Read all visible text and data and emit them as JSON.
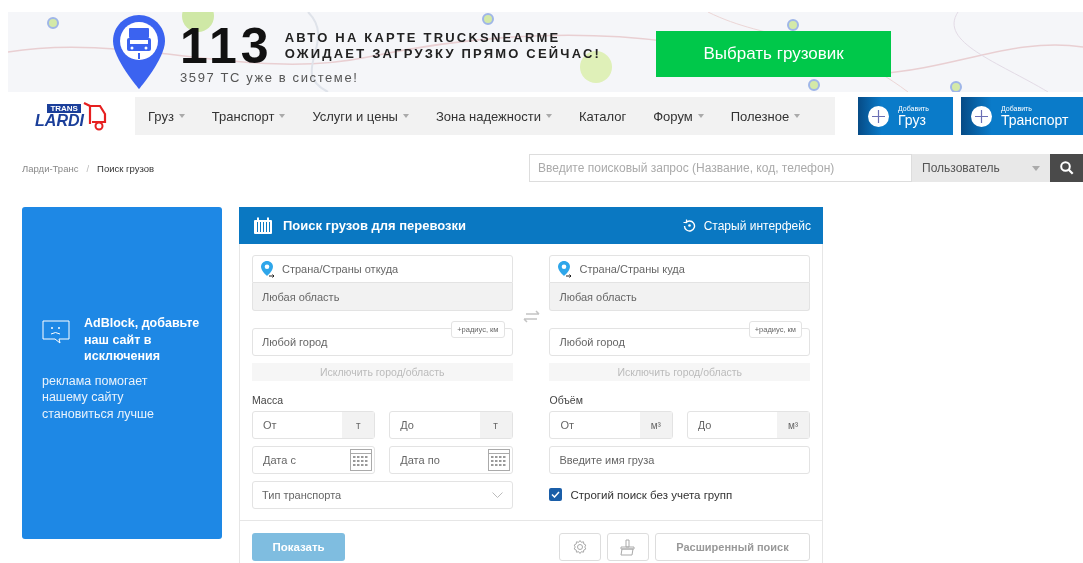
{
  "promo": {
    "count": "113",
    "headline_1": "АВТО НА КАРТЕ TRUCKSNEARME",
    "headline_2": "ОЖИДАЕТ ЗАГРУЗКУ ПРЯМО СЕЙЧАС!",
    "subline": "3597 ТС уже в системе!",
    "button": "Выбрать грузовик"
  },
  "logo": {
    "badge": "TRANS",
    "name": "LARDI"
  },
  "menu": [
    {
      "label": "Груз",
      "dropdown": true
    },
    {
      "label": "Транспорт",
      "dropdown": true
    },
    {
      "label": "Услуги и цены",
      "dropdown": true
    },
    {
      "label": "Зона надежности",
      "dropdown": true
    },
    {
      "label": "Каталог",
      "dropdown": false
    },
    {
      "label": "Форум",
      "dropdown": true
    },
    {
      "label": "Полезное",
      "dropdown": true
    }
  ],
  "add_buttons": [
    {
      "caption": "Добавить",
      "label": "Груз"
    },
    {
      "caption": "Добавить",
      "label": "Транспорт"
    }
  ],
  "breadcrumb": {
    "separator": "/",
    "items": [
      {
        "label": "Ларди-Транс",
        "current": false
      },
      {
        "label": "Поиск грузов",
        "current": true
      }
    ]
  },
  "site_search": {
    "placeholder": "Введите поисковый запрос (Название, код, телефон)",
    "scope": "Пользователь"
  },
  "ad": {
    "title": "AdBlock, добавьте наш сайт в исключения",
    "text": "реклама помогает нашему сайту становиться лучше"
  },
  "form": {
    "title": "Поиск грузов для перевозки",
    "old_interface": "Старый интерфейс",
    "directions": [
      {
        "country_placeholder": "Страна/Страны откуда",
        "region": "Любая область",
        "city_placeholder": "Любой город",
        "radius": "+радиус, км",
        "exclude": "Исключить город/область",
        "exclude_disabled": true
      },
      {
        "country_placeholder": "Страна/Страны куда",
        "region": "Любая область",
        "city_placeholder": "Любой город",
        "radius": "+радиус, км",
        "exclude": "Исключить город/область",
        "exclude_disabled": true
      }
    ],
    "mass": {
      "label": "Масса",
      "from_placeholder": "От",
      "from_unit": "т",
      "to_placeholder": "До",
      "to_unit": "т"
    },
    "volume": {
      "label": "Объём",
      "from_placeholder": "От",
      "from_unit": "м³",
      "to_placeholder": "До",
      "to_unit": "м³"
    },
    "dates": {
      "from_placeholder": "Дата с",
      "to_placeholder": "Дата по"
    },
    "transport_type": "Тип транспорта",
    "cargo_name_placeholder": "Введите имя груза",
    "strict": {
      "label": "Строгий поиск без учета групп",
      "checked": true
    },
    "show_button": {
      "label": "Показать",
      "disabled": true
    },
    "advanced_button": "Расширенный поиск"
  }
}
